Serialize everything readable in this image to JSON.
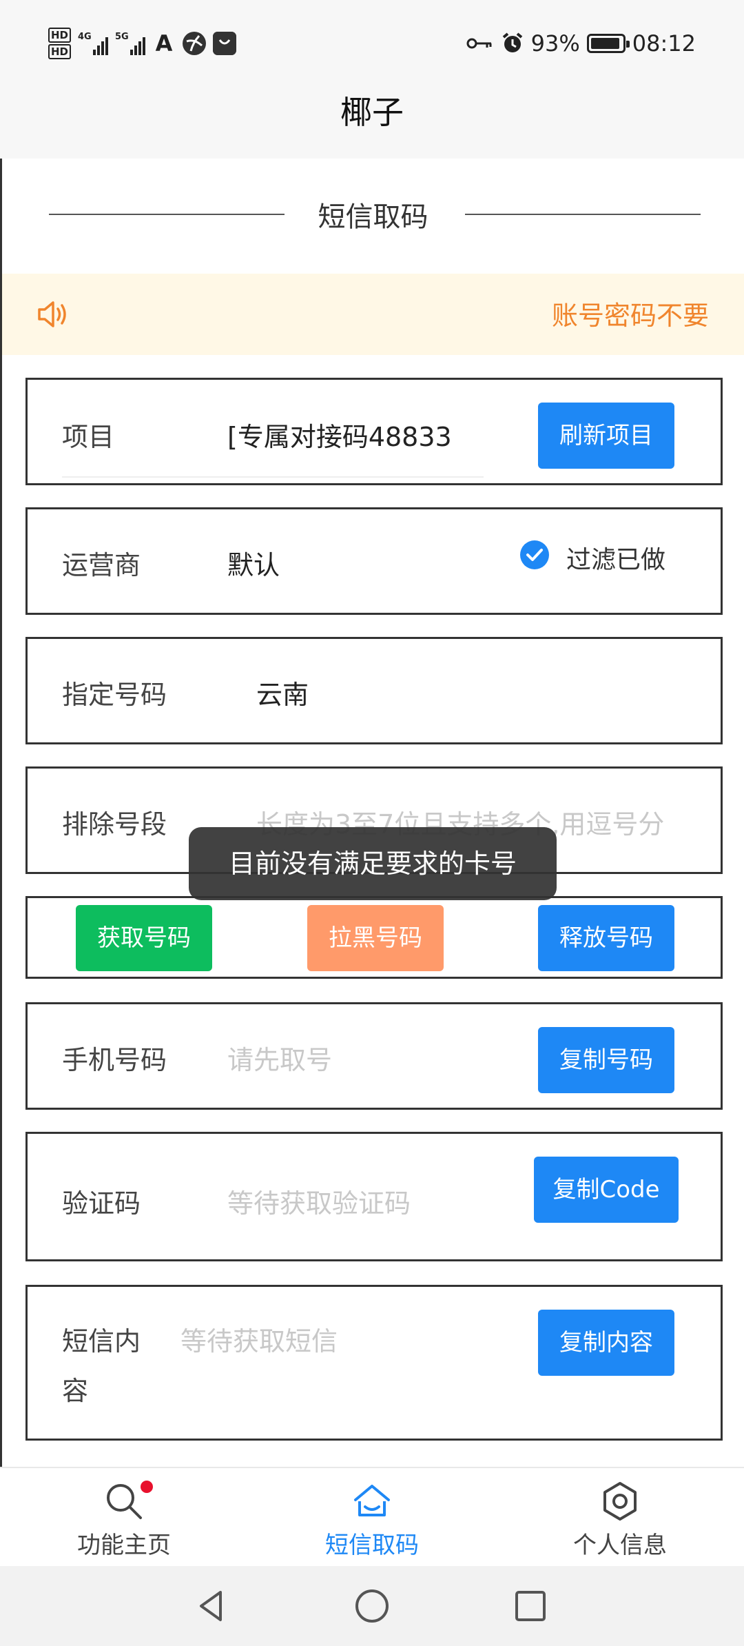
{
  "status_bar": {
    "hd1": "HD",
    "hd2": "HD",
    "net1": "4G",
    "net2": "5G",
    "app_icon_1": "A",
    "battery_percent": "93%",
    "time": "08:12",
    "icons": [
      "key-icon",
      "alarm-icon",
      "battery-icon"
    ]
  },
  "header": {
    "title": "椰子"
  },
  "section": {
    "title": "短信取码"
  },
  "notice": {
    "text": "账号密码不要",
    "icon": "speaker-icon",
    "color": "#f0852d"
  },
  "form": {
    "project": {
      "label": "项目",
      "value": "[专属对接码48833",
      "button": "刷新项目"
    },
    "operator": {
      "label": "运营商",
      "value": "默认",
      "checkbox_label": "过滤已做",
      "checked": true
    },
    "specified_number": {
      "label": "指定号码",
      "value": "云南"
    },
    "exclude_segment": {
      "label": "排除号段",
      "placeholder": "长度为3至7位且支持多个,用逗号分"
    },
    "actions": {
      "get": "获取号码",
      "blacklist": "拉黑号码",
      "release": "释放号码"
    },
    "phone": {
      "label": "手机号码",
      "placeholder": "请先取号",
      "button": "复制号码"
    },
    "code": {
      "label": "验证码",
      "placeholder": "等待获取验证码",
      "button": "复制Code"
    },
    "sms": {
      "label_line1": "短信内",
      "label_line2": "容",
      "placeholder": "等待获取短信",
      "button": "复制内容"
    }
  },
  "toast": {
    "text": "目前没有满足要求的卡号"
  },
  "bottom_nav": {
    "tabs": [
      {
        "label": "功能主页",
        "icon": "search-icon",
        "badge": true
      },
      {
        "label": "短信取码",
        "icon": "home-icon",
        "active": true
      },
      {
        "label": "个人信息",
        "icon": "gear-icon"
      }
    ]
  },
  "colors": {
    "accent": "#1e88f5",
    "green": "#0dbd5e",
    "orange": "#ff9a6a",
    "notice_bg": "#fff8e6"
  }
}
